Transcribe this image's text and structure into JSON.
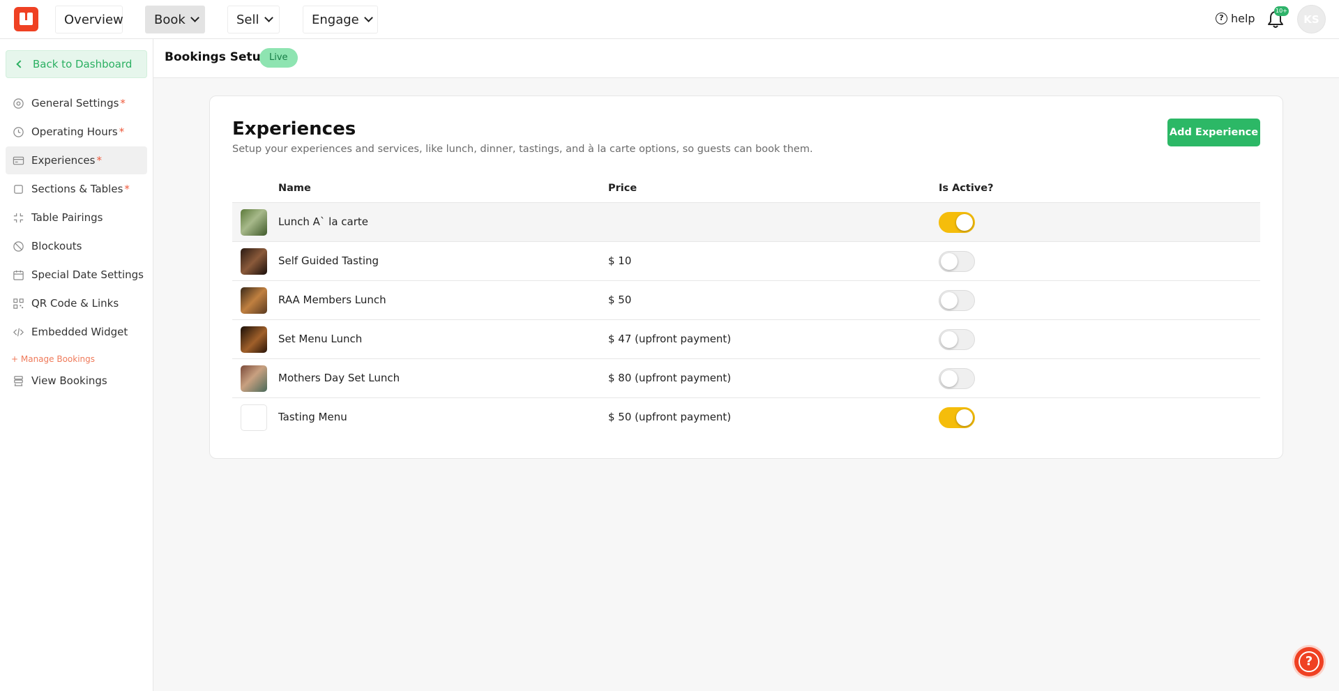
{
  "topnav": {
    "items": [
      {
        "label": "Overview"
      },
      {
        "label": "Book"
      },
      {
        "label": "Sell"
      },
      {
        "label": "Engage"
      }
    ],
    "help_label": "help",
    "notification_badge": "10+",
    "avatar_initials": "KS"
  },
  "sidebar": {
    "back_label": "Back to Dashboard",
    "items": [
      {
        "label": "General Settings",
        "required": "*",
        "icon": "gear-icon"
      },
      {
        "label": "Operating Hours",
        "required": "*",
        "icon": "clock-icon"
      },
      {
        "label": "Experiences",
        "required": "*",
        "icon": "card-icon"
      },
      {
        "label": "Sections & Tables",
        "required": "*",
        "icon": "square-icon"
      },
      {
        "label": "Table Pairings",
        "required": "",
        "icon": "compress-icon"
      },
      {
        "label": "Blockouts",
        "required": "",
        "icon": "block-icon"
      },
      {
        "label": "Special Date Settings",
        "required": "",
        "icon": "calendar-icon"
      },
      {
        "label": "QR Code & Links",
        "required": "",
        "icon": "qr-icon"
      },
      {
        "label": "Embedded Widget",
        "required": "",
        "icon": "code-icon"
      }
    ],
    "manage_label": "+ Manage Bookings",
    "view_bookings_label": "View Bookings"
  },
  "subheader": {
    "title": "Bookings Setup",
    "status": "Live"
  },
  "experiences": {
    "title": "Experiences",
    "subtitle": "Setup your experiences and services, like lunch, dinner, tastings, and à la carte options, so guests can book them.",
    "add_button": "Add Experience",
    "columns": {
      "name": "Name",
      "price": "Price",
      "active": "Is Active?"
    },
    "rows": [
      {
        "name": "Lunch A` la carte",
        "price": "",
        "active": true
      },
      {
        "name": "Self Guided Tasting",
        "price": "$ 10",
        "active": false
      },
      {
        "name": "RAA Members Lunch",
        "price": "$ 50",
        "active": false
      },
      {
        "name": "Set Menu Lunch",
        "price": "$ 47 (upfront payment)",
        "active": false
      },
      {
        "name": "Mothers Day Set Lunch",
        "price": "$ 80 (upfront payment)",
        "active": false
      },
      {
        "name": "Tasting Menu",
        "price": "$ 50 (upfront payment)",
        "active": true
      }
    ]
  },
  "help_fab": "?",
  "colors": {
    "brand": "#ef4123",
    "accent_green": "#2cb866",
    "toggle_on": "#f5bd0b"
  }
}
